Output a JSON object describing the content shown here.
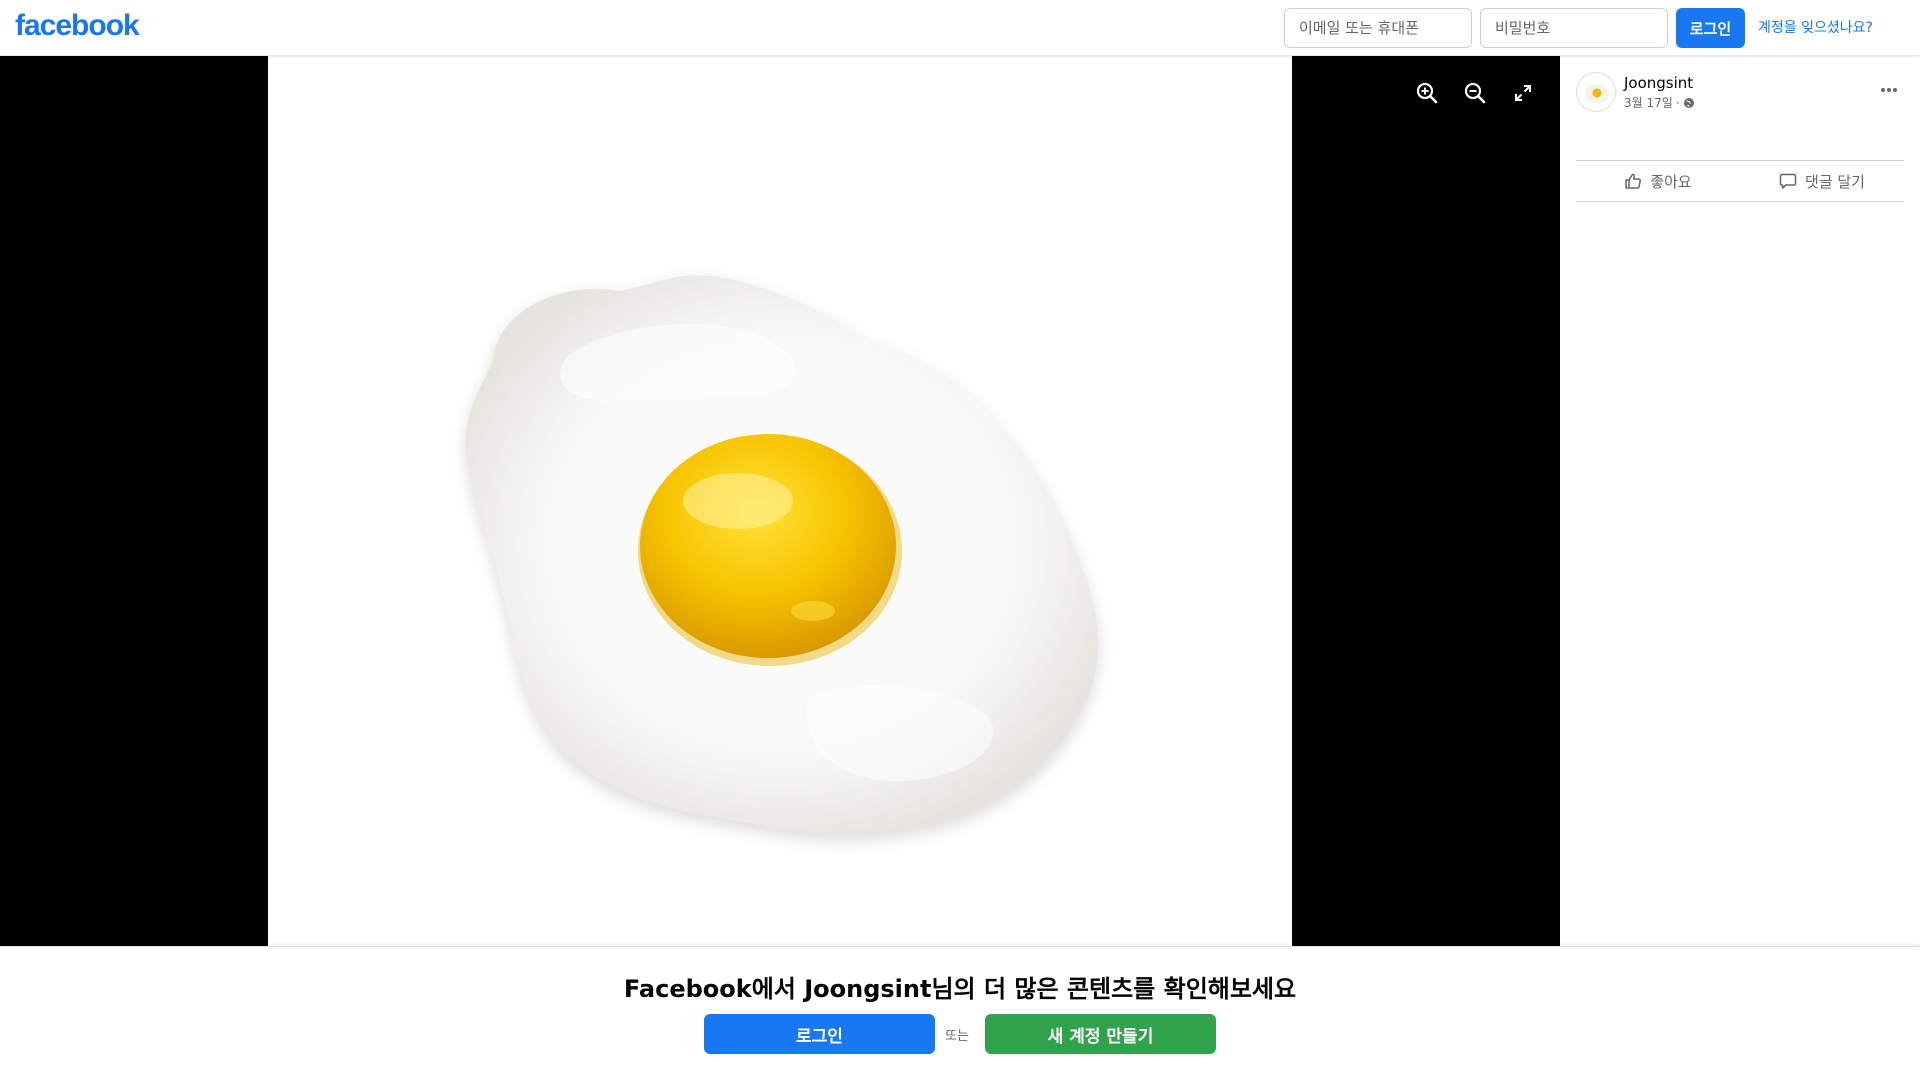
{
  "header": {
    "logo_text": "facebook",
    "email_placeholder": "이메일 또는 휴대폰",
    "password_placeholder": "비밀번호",
    "login_label": "로그인",
    "forgot_label": "계정을 잊으셨나요?"
  },
  "viewer": {
    "zoom_in_icon": "zoom-in-icon",
    "zoom_out_icon": "zoom-out-icon",
    "fullscreen_icon": "fullscreen-icon"
  },
  "post": {
    "author": "Joongsint",
    "date": "3월 17일",
    "separator": "·",
    "privacy_icon": "globe-icon",
    "like_label": "좋아요",
    "comment_label": "댓글 달기"
  },
  "banner": {
    "title": "Facebook에서 Joongsint님의 더 많은 콘텐츠를 확인해보세요",
    "login_label": "로그인",
    "or_label": "또는",
    "signup_label": "새 계정 만들기"
  },
  "colors": {
    "brand": "#1877f2",
    "signup_green": "#31a24c",
    "viewer_bg": "#000000",
    "yolk": "#f5b700"
  }
}
